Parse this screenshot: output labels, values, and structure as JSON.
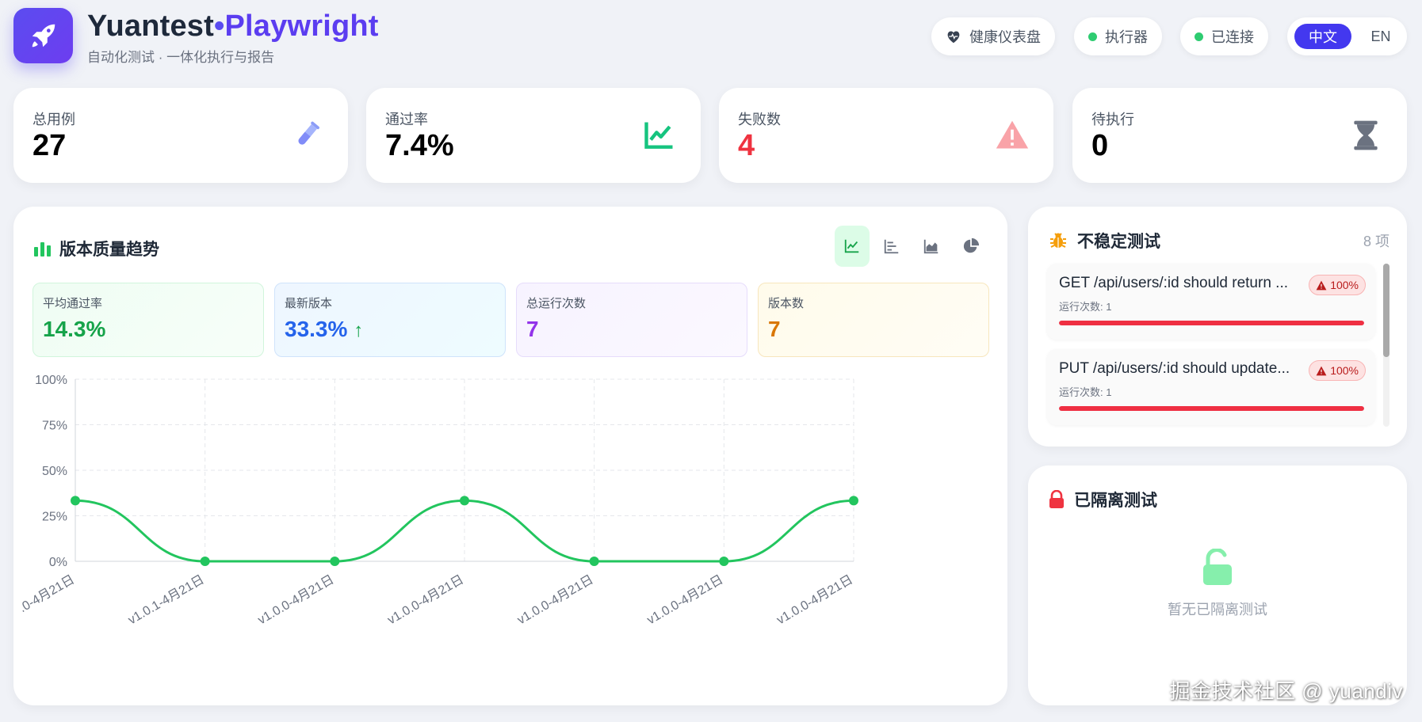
{
  "header": {
    "brand_name": "Yuantest",
    "brand_dot": "•",
    "brand_product": "Playwright",
    "subtitle": "自动化测试 · 一体化执行与报告",
    "health_label": "健康仪表盘",
    "executor_label": "执行器",
    "connection_label": "已连接",
    "lang_zh": "中文",
    "lang_en": "EN",
    "status_color": "#2ecc71",
    "accent": "#4338ef"
  },
  "stats": [
    {
      "label": "总用例",
      "value": "27",
      "icon": "test-tube-icon",
      "color": "#000000"
    },
    {
      "label": "通过率",
      "value": "7.4%",
      "icon": "line-chart-icon",
      "color": "#000000"
    },
    {
      "label": "失败数",
      "value": "4",
      "icon": "warning-icon",
      "color": "#ef3340"
    },
    {
      "label": "待执行",
      "value": "0",
      "icon": "hourglass-icon",
      "color": "#000000"
    }
  ],
  "trend": {
    "title": "版本质量趋势",
    "summary": [
      {
        "label": "平均通过率",
        "value": "14.3%",
        "color": "#16a34a"
      },
      {
        "label": "最新版本",
        "value": "33.3%",
        "arrow": "↑",
        "color": "#2563eb"
      },
      {
        "label": "总运行次数",
        "value": "7",
        "color": "#9333ea"
      },
      {
        "label": "版本数",
        "value": "7",
        "color": "#d97706"
      }
    ]
  },
  "chart_data": {
    "type": "line",
    "categories": [
      ".0-4月21日",
      "v1.0.1-4月21日",
      "v1.0.0-4月21日",
      "v1.0.0-4月21日",
      "v1.0.0-4月21日",
      "v1.0.0-4月21日",
      "v1.0.0-4月21日"
    ],
    "series": [
      {
        "values": [
          33.3,
          0,
          0,
          33.3,
          0,
          0,
          33.3
        ],
        "color": "#22c55e"
      }
    ],
    "ylim": [
      0,
      100
    ],
    "yticks": [
      "0%",
      "25%",
      "50%",
      "75%",
      "100%"
    ],
    "grid": true
  },
  "flaky": {
    "title": "不稳定测试",
    "count": "8 项",
    "items": [
      {
        "name": "GET /api/users/:id should return ...",
        "runs": "运行次数: 1",
        "rate": "100%",
        "fill": 1.0
      },
      {
        "name": "PUT /api/users/:id should update...",
        "runs": "运行次数: 1",
        "rate": "100%",
        "fill": 1.0
      }
    ]
  },
  "quarantine": {
    "title": "已隔离测试",
    "empty_text": "暂无已隔离测试"
  },
  "watermark": "掘金技术社区 @ yuandiv"
}
